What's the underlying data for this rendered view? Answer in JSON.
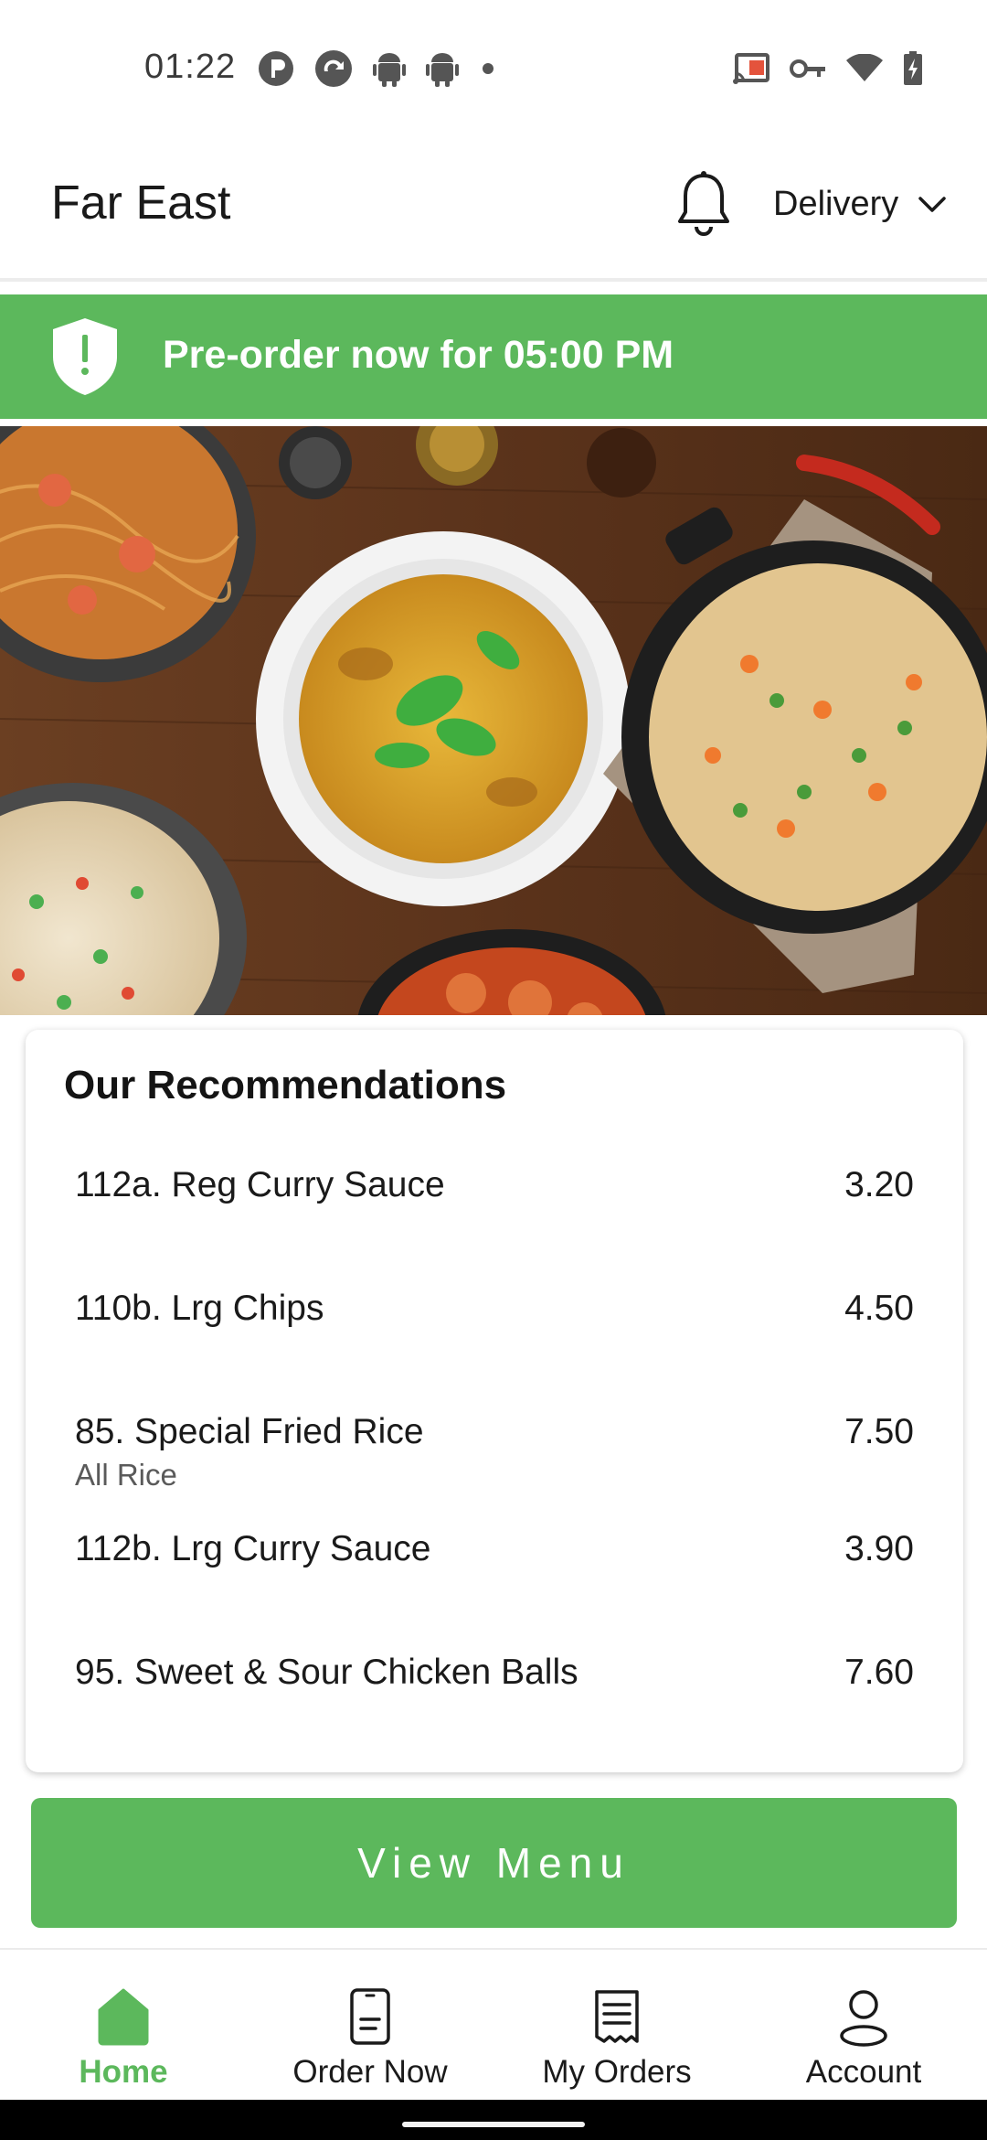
{
  "status_bar": {
    "time": "01:22"
  },
  "header": {
    "app_title": "Far East",
    "delivery_mode": "Delivery"
  },
  "banner": {
    "text": "Pre-order now for 05:00 PM",
    "color": "#5cb85c"
  },
  "recommendations": {
    "title": "Our Recommendations",
    "items": [
      {
        "name": "112a. Reg Curry Sauce",
        "price": "3.20",
        "category": ""
      },
      {
        "name": "110b. Lrg Chips",
        "price": "4.50",
        "category": ""
      },
      {
        "name": "85. Special Fried Rice",
        "price": "7.50",
        "category": "All Rice"
      },
      {
        "name": "112b. Lrg Curry Sauce",
        "price": "3.90",
        "category": ""
      },
      {
        "name": "95. Sweet & Sour Chicken Balls",
        "price": "7.60",
        "category": ""
      }
    ]
  },
  "view_menu_label": "View Menu",
  "bottom_nav": {
    "items": [
      {
        "label": "Home",
        "icon": "home-icon",
        "active": true
      },
      {
        "label": "Order Now",
        "icon": "order-now-icon",
        "active": false
      },
      {
        "label": "My Orders",
        "icon": "receipt-icon",
        "active": false
      },
      {
        "label": "Account",
        "icon": "person-icon",
        "active": false
      }
    ]
  },
  "colors": {
    "accent": "#5cb85c",
    "text": "#1a1a1a"
  }
}
